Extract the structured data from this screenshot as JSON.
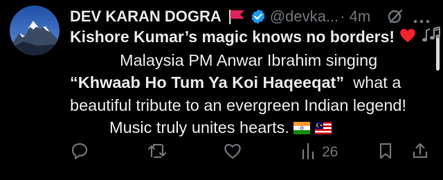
{
  "author": {
    "name": "DEV KARAN DOGRA",
    "handle": "@devka...",
    "time": "· 4m"
  },
  "tweet": {
    "line1": "Kishore Kumar’s magic knows no borders!",
    "line2": "Malaysia PM Anwar Ibrahim singing",
    "line3_quote": "“Khwaab Ho Tum Ya Koi Haqeeqat”",
    "line3_rest": "  what a",
    "line4": "beautiful tribute to an evergreen Indian legend!",
    "line5": "Music truly unites hearts."
  },
  "actions": {
    "views_count": "26"
  },
  "colors": {
    "background": "#000000",
    "text": "#e7e9ea",
    "muted": "#71767b",
    "verified": "#1d9bf0",
    "heart": "#f4212e"
  },
  "icons": [
    "flag-icon",
    "verified-icon",
    "grok-icon",
    "more-icon",
    "heart-emoji",
    "music-notes-emoji",
    "india-flag-emoji",
    "malaysia-flag-emoji",
    "reply-icon",
    "retweet-icon",
    "like-icon",
    "views-icon",
    "bookmark-icon",
    "share-icon"
  ]
}
